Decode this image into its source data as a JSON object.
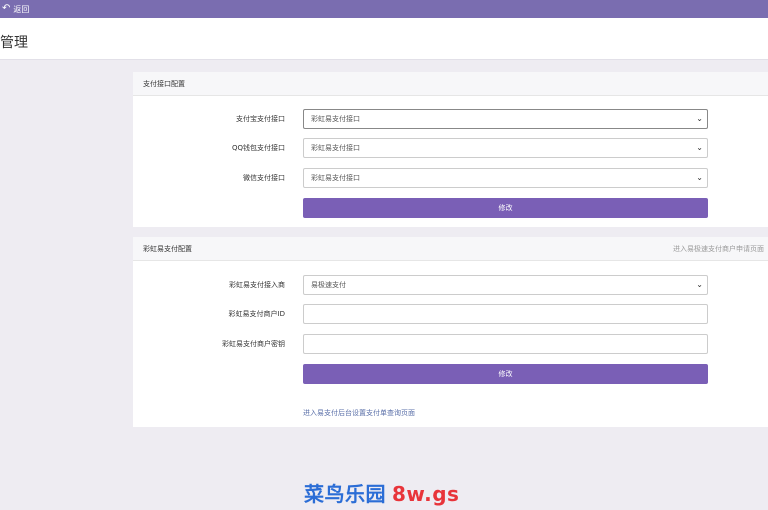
{
  "topbar": {
    "back_label": "返回"
  },
  "header": {
    "title": "管理"
  },
  "panel1": {
    "title": "支付接口配置",
    "fields": [
      {
        "label": "支付宝支付接口",
        "value": "彩虹易支付接口"
      },
      {
        "label": "QQ钱包支付接口",
        "value": "彩虹易支付接口"
      },
      {
        "label": "微信支付接口",
        "value": "彩虹易支付接口"
      }
    ],
    "submit_label": "修改"
  },
  "panel2": {
    "title": "彩虹易支付配置",
    "head_link": "进入易极速支付商户申请页面",
    "fields": [
      {
        "label": "彩虹易支付接入商",
        "value": "易极速支付"
      },
      {
        "label": "彩虹易支付商户ID",
        "value": ""
      },
      {
        "label": "彩虹易支付商户密钥",
        "value": ""
      }
    ],
    "submit_label": "修改",
    "help_link": "进入易支付后台设置支付单查询页面"
  },
  "watermark": {
    "cn": "菜鸟乐园",
    "en": "8w.gs"
  }
}
